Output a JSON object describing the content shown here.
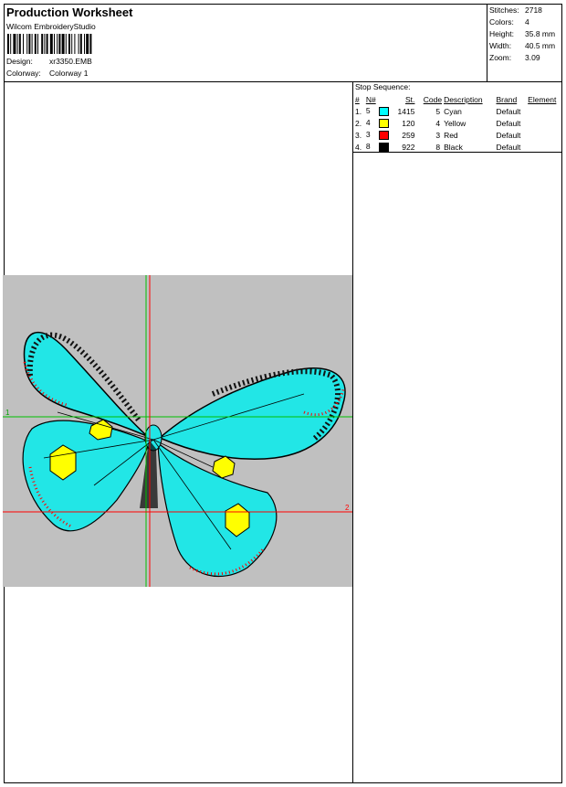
{
  "header": {
    "title": "Production Worksheet",
    "company": "Wilcom EmbroideryStudio",
    "design_label": "Design:",
    "design_value": "xr3350.EMB",
    "colorway_label": "Colorway:",
    "colorway_value": "Colorway 1"
  },
  "stats": [
    {
      "label": "Stitches:",
      "value": "2718"
    },
    {
      "label": "Colors:",
      "value": "4"
    },
    {
      "label": "Height:",
      "value": "35.8 mm"
    },
    {
      "label": "Width:",
      "value": "40.5 mm"
    },
    {
      "label": "Zoom:",
      "value": "3.09"
    }
  ],
  "stop_sequence": {
    "title": "Stop Sequence:",
    "columns": [
      "#",
      "N#",
      "St.",
      "Code",
      "Description",
      "Brand",
      "Element"
    ],
    "rows": [
      {
        "num": "1.",
        "n": "5",
        "color": "#00ffff",
        "st": "1415",
        "code": "5",
        "desc": "Cyan",
        "brand": "Default",
        "element": ""
      },
      {
        "num": "2.",
        "n": "4",
        "color": "#ffff00",
        "st": "120",
        "code": "4",
        "desc": "Yellow",
        "brand": "Default",
        "element": ""
      },
      {
        "num": "3.",
        "n": "3",
        "color": "#ff0000",
        "st": "259",
        "code": "3",
        "desc": "Red",
        "brand": "Default",
        "element": ""
      },
      {
        "num": "4.",
        "n": "8",
        "color": "#000000",
        "st": "922",
        "code": "8",
        "desc": "Black",
        "brand": "Default",
        "element": ""
      }
    ]
  },
  "preview": {
    "marker_1": "1",
    "marker_2": "2",
    "background_color": "#c0c0c0",
    "thread_colors": [
      "#00ffff",
      "#ffff00",
      "#ff0000",
      "#000000"
    ]
  }
}
